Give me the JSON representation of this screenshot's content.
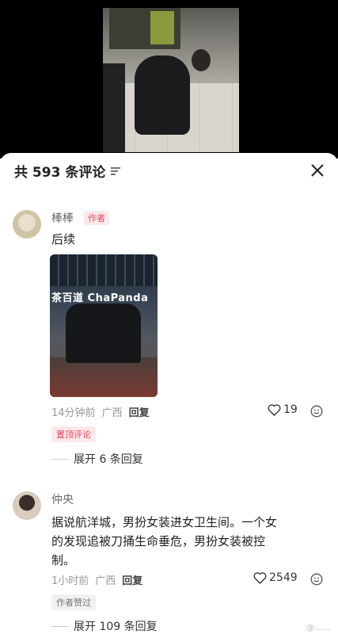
{
  "header": {
    "title": "共 593 条评论"
  },
  "video_sign": "茶百道 ChaPanda",
  "comments": [
    {
      "name": "棒棒",
      "badge": "作者",
      "text": "后续",
      "time": "14分钟前",
      "location": "广西",
      "reply": "回复",
      "likes": "19",
      "tag": "置顶评论",
      "expand": "展开 6 条回复"
    },
    {
      "name": "仲央",
      "text_lines": [
        "据说航洋城，男扮女装进女卫生间。一个女",
        "的发现追被刀捅生命垂危，男扮女装被控",
        "制。"
      ],
      "time": "1小时前",
      "location": "广西",
      "reply": "回复",
      "likes": "2549",
      "tag": "作者赞过",
      "expand": "展开 109 条回复"
    }
  ],
  "watermark": "@……"
}
